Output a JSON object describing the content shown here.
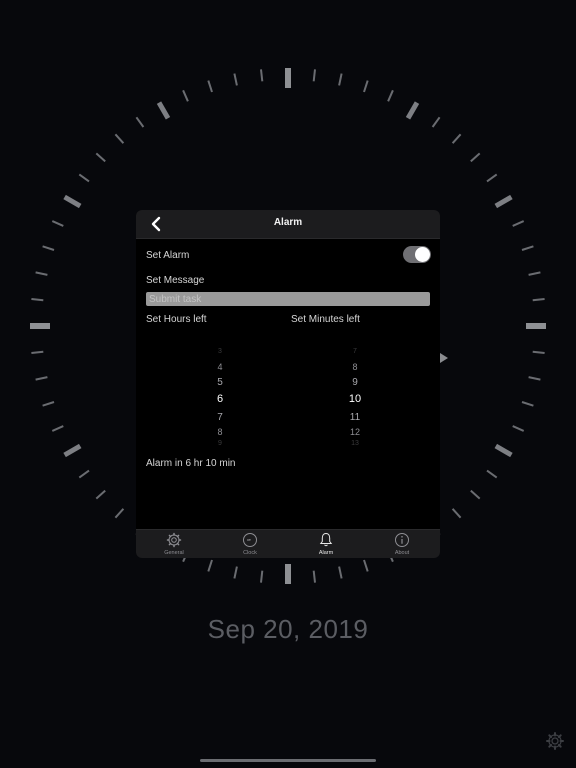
{
  "screen": {
    "date": "Sep 20, 2019"
  },
  "alarm_panel": {
    "title": "Alarm",
    "back_icon": "chevron-left-icon",
    "set_alarm_label": "Set Alarm",
    "set_alarm_on": true,
    "set_message_label": "Set Message",
    "message_value": "",
    "message_placeholder": "Submit task",
    "hours_label": "Set Hours left",
    "minutes_label": "Set Minutes left",
    "hours_picker": {
      "visible_values": [
        "3",
        "4",
        "5",
        "6",
        "7",
        "8",
        "9"
      ],
      "selected": "6"
    },
    "minutes_picker": {
      "visible_values": [
        "7",
        "8",
        "9",
        "10",
        "11",
        "12",
        "13"
      ],
      "selected": "10"
    },
    "status": "Alarm in 6 hr 10 min"
  },
  "tabbar": {
    "tabs": [
      {
        "label": "General",
        "icon": "gear-icon",
        "active": false
      },
      {
        "label": "Clock",
        "icon": "clock-icon",
        "active": false
      },
      {
        "label": "Alarm",
        "icon": "bell-icon",
        "active": true
      },
      {
        "label": "About",
        "icon": "info-icon",
        "active": false
      }
    ]
  },
  "colors": {
    "background": "#07080c",
    "tick": "#8a8c90",
    "panel": "#000000",
    "bar": "#1c1c1e"
  }
}
